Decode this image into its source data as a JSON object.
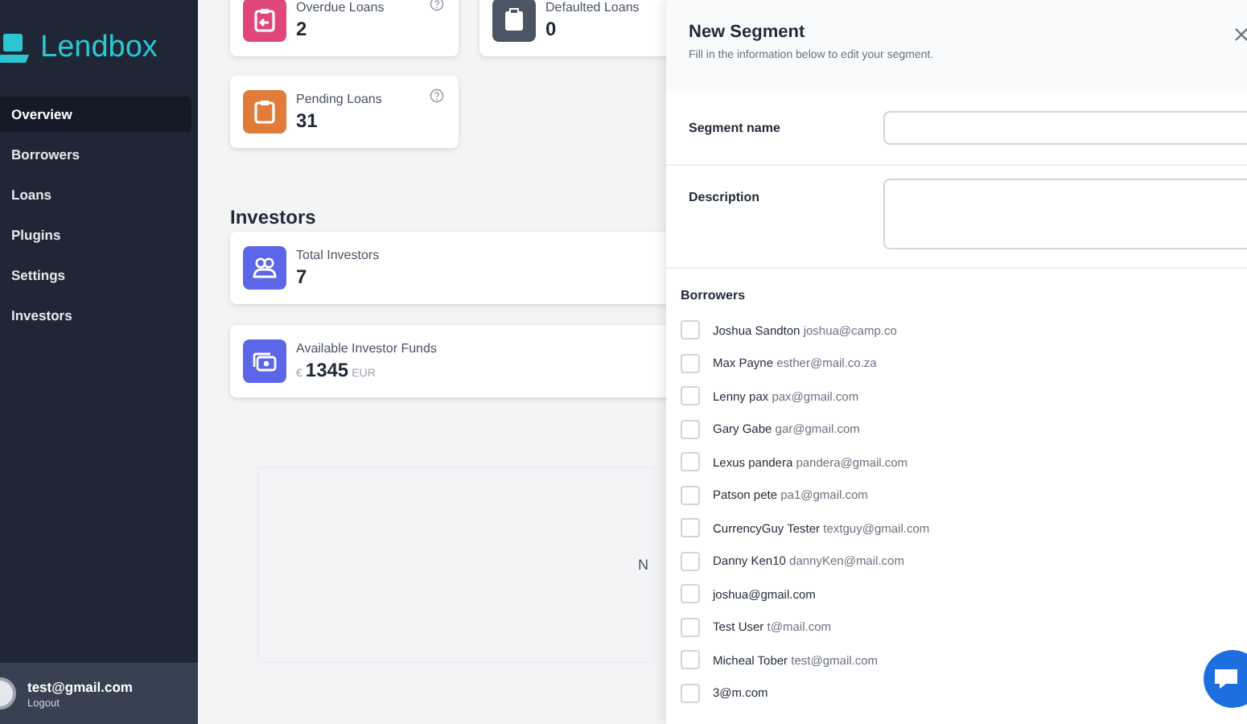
{
  "sidebar": {
    "logo": "Lendbox",
    "items": [
      {
        "label": "Overview",
        "selected": true
      },
      {
        "label": "Borrowers",
        "selected": false
      },
      {
        "label": "Loans",
        "selected": false
      },
      {
        "label": "Plugins",
        "selected": false
      },
      {
        "label": "Settings",
        "selected": false
      },
      {
        "label": "Investors",
        "selected": false
      }
    ],
    "user": {
      "email": "test@gmail.com",
      "action": "Logout"
    }
  },
  "loan_stats": [
    {
      "label": "Overdue Loans",
      "value": "2",
      "kind": "overdue",
      "help": true
    },
    {
      "label": "Defaulted Loans",
      "value": "0",
      "kind": "defaulted",
      "help": false
    },
    {
      "label": "Pending Loans",
      "value": "31",
      "kind": "pending",
      "help": true
    }
  ],
  "investors": {
    "title": "Investors",
    "cards": [
      {
        "label": "Total Investors",
        "value": "7",
        "kind": "people"
      },
      {
        "label": "Available Investor Funds",
        "currency": "€",
        "value": "1345",
        "unit": "EUR",
        "kind": "money"
      }
    ]
  },
  "empty_state": {
    "text": "N"
  },
  "panel": {
    "title": "New Segment",
    "subtitle": "Fill in the information below to edit your segment.",
    "fields": [
      {
        "label": "Segment name",
        "kind": "input"
      },
      {
        "label": "Description",
        "kind": "textarea"
      }
    ],
    "borrowers_title": "Borrowers",
    "borrowers": [
      {
        "name": "Joshua Sandton",
        "email": "joshua@camp.co",
        "checked": false
      },
      {
        "name": "Max Payne",
        "email": "esther@mail.co.za",
        "checked": false
      },
      {
        "name": "Lenny pax",
        "email": "pax@gmail.com",
        "checked": false
      },
      {
        "name": "Gary Gabe",
        "email": "gar@gmail.com",
        "checked": false
      },
      {
        "name": "Lexus pandera",
        "email": "pandera@gmail.com",
        "checked": false
      },
      {
        "name": "Patson pete",
        "email": "pa1@gmail.com",
        "checked": false
      },
      {
        "name": "CurrencyGuy Tester",
        "email": "textguy@gmail.com",
        "checked": false
      },
      {
        "name": "Danny Ken10",
        "email": "dannyKen@mail.com",
        "checked": false
      },
      {
        "name": "joshua@gmail.com",
        "checked": false
      },
      {
        "name": "Test User",
        "email": "t@mail.com",
        "checked": false
      },
      {
        "name": "Micheal Tober",
        "email": "test@gmail.com",
        "checked": false
      },
      {
        "name": "3@m.com",
        "checked": false
      }
    ]
  }
}
